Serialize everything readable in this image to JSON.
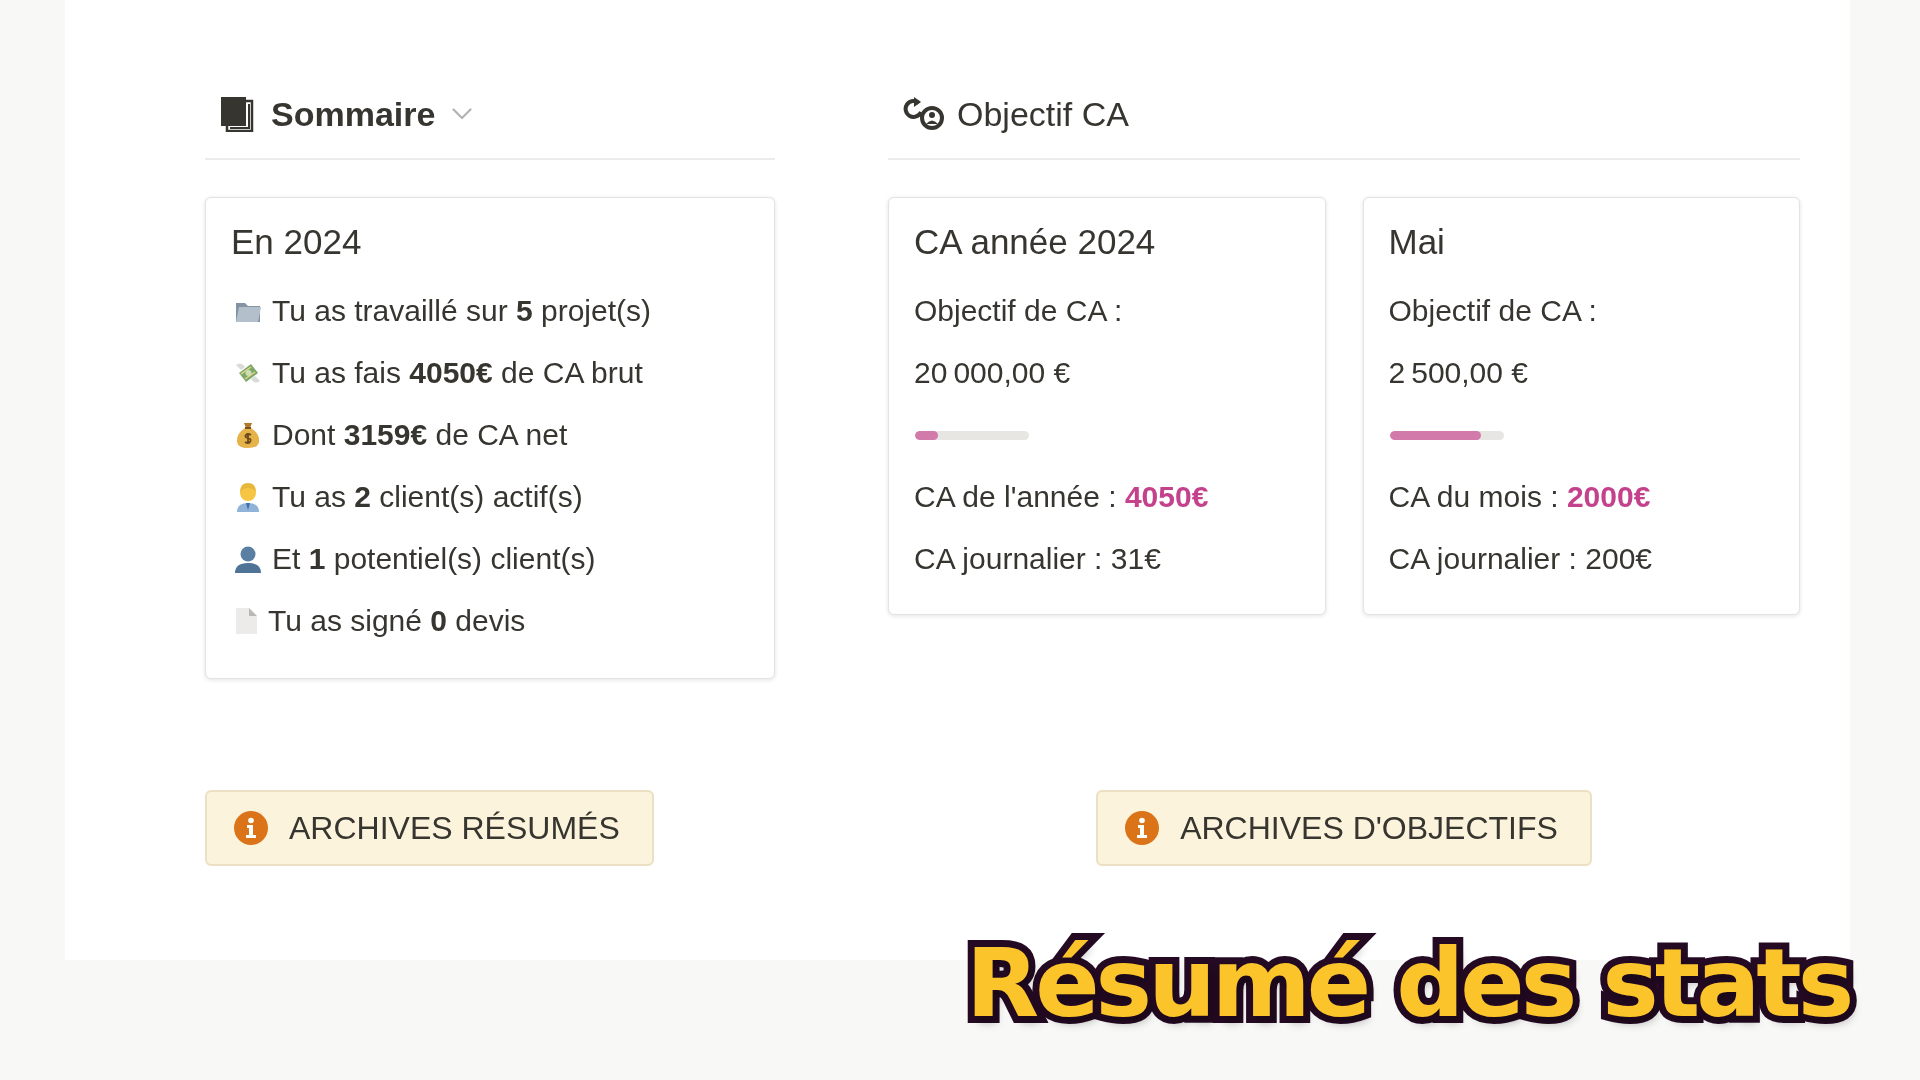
{
  "summary": {
    "heading": "Sommaire",
    "card": {
      "title": "En 2024",
      "items": [
        "Tu as travaillé sur **5** projet(s)",
        "Tu as fais **4050€** de CA brut",
        "Dont **3159€** de CA net",
        "Tu as **2** client(s) actif(s)",
        "Et **1** potentiel(s) client(s)",
        "Tu as signé **0** devis"
      ]
    },
    "button": "ARCHIVES RÉSUMÉS"
  },
  "objectives": {
    "heading": "Objectif CA",
    "cards": [
      {
        "title": "CA année 2024",
        "goal_label": "Objectif de CA :",
        "goal_value": "20 000,00 €",
        "level": 0.2025,
        "revenue": "CA de l'année : **4050€**",
        "daily": "CA journalier : 31€"
      },
      {
        "title": "Mai",
        "goal_label": "Objectif de CA :",
        "goal_value": "2 500,00 €",
        "level": 0.8,
        "revenue": "CA du mois : **2000€**",
        "daily": "CA journalier : 200€"
      }
    ],
    "button": "ARCHIVES D'OBJECTIFS"
  },
  "caption": "Résumé des stats"
}
